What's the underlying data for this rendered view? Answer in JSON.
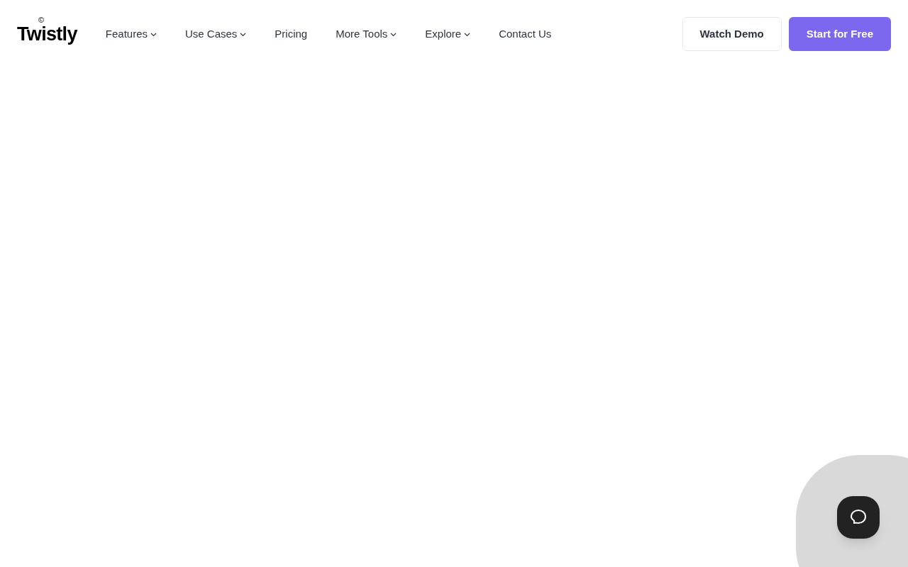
{
  "logo": {
    "name": "Twistly",
    "mark": "©"
  },
  "nav": [
    {
      "label": "Features",
      "dropdown": true
    },
    {
      "label": "Use Cases",
      "dropdown": true
    },
    {
      "label": "Pricing",
      "dropdown": false
    },
    {
      "label": "More Tools",
      "dropdown": true
    },
    {
      "label": "Explore",
      "dropdown": true
    },
    {
      "label": "Contact Us",
      "dropdown": false
    }
  ],
  "actions": [
    {
      "label": "Watch Demo",
      "kind": "outline"
    },
    {
      "label": "Start for Free",
      "kind": "primary"
    }
  ]
}
